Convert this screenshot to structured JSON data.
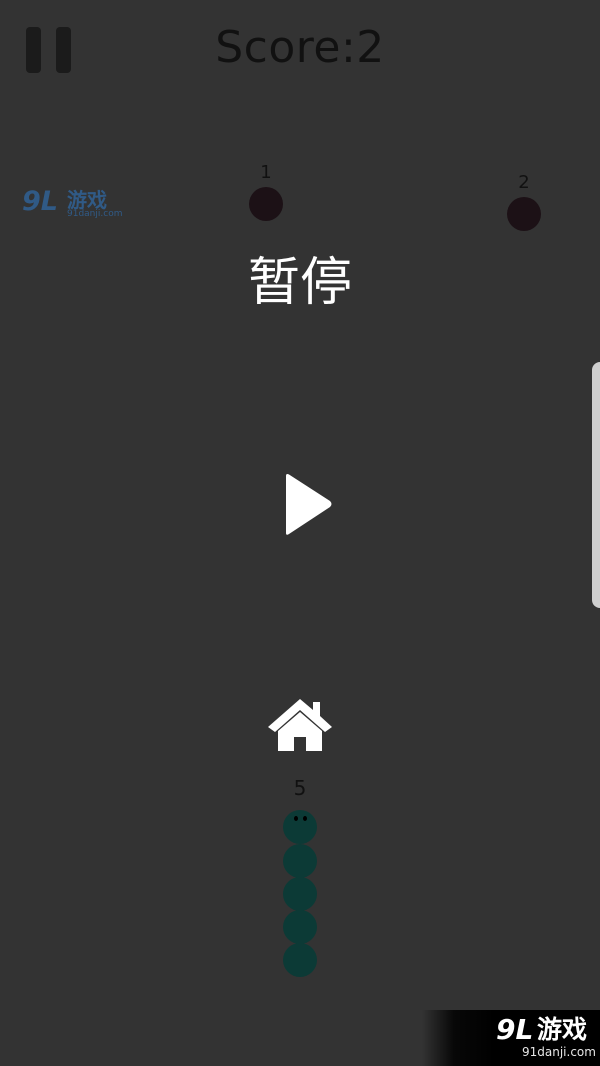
{
  "hud": {
    "score_text": "Score:2"
  },
  "watermark_top": {
    "logo": "9L",
    "name": "游戏",
    "url": "91danji.com"
  },
  "foods": [
    {
      "label": "1",
      "color": "#1c1116"
    },
    {
      "label": "2",
      "color": "#1c1116"
    }
  ],
  "pause_menu": {
    "title": "暂停",
    "play_icon": "play-icon",
    "home_icon": "home-icon"
  },
  "snake": {
    "length_label": "5",
    "segments": 5,
    "color": "#0c3a36"
  },
  "watermark_bottom": {
    "logo": "9L",
    "name": "游戏",
    "url": "91danji.com"
  },
  "colors": {
    "background": "#333333",
    "text_dark": "#111111",
    "text_light": "#ffffff"
  }
}
